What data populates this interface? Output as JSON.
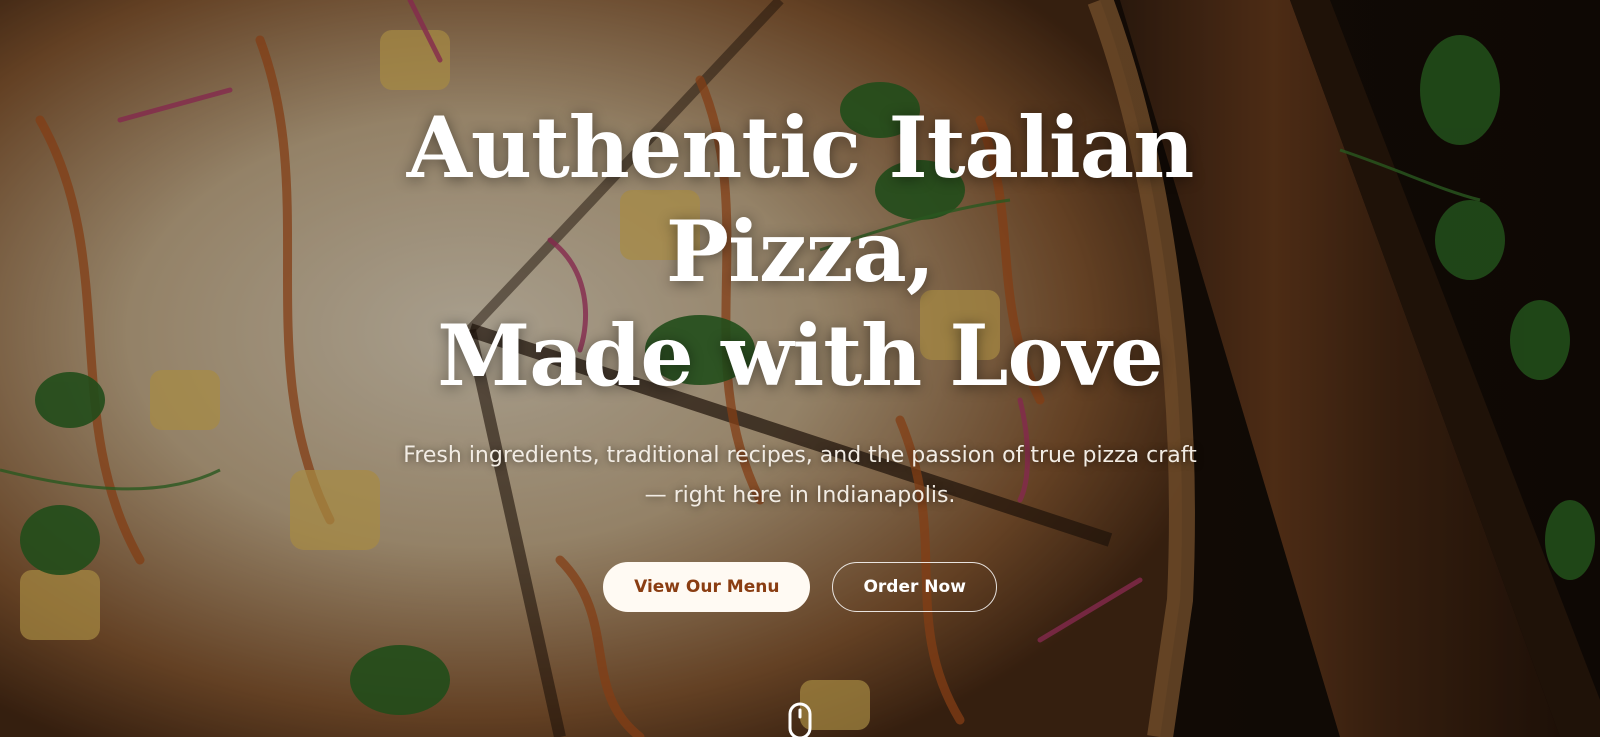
{
  "hero": {
    "title_line1": "Authentic Italian",
    "title_line2": "Pizza,",
    "title_line3": "Made with Love",
    "subtitle": "Fresh ingredients, traditional recipes, and the passion of true pizza craft — right here in Indianapolis.",
    "primary_button": "View Our Menu",
    "secondary_button": "Order Now",
    "scroll_icon": "mouse-scroll-icon",
    "background_image": "pizza-on-wooden-board-photo"
  },
  "colors": {
    "primary_button_bg": "#fffaf3",
    "primary_button_text": "#8a3d12",
    "text": "#ffffff"
  }
}
